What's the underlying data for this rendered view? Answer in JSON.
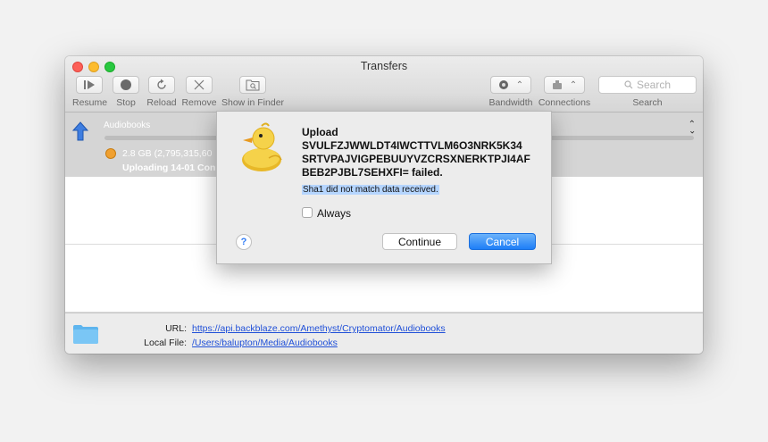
{
  "window": {
    "title": "Transfers"
  },
  "toolbar": {
    "resume": "Resume",
    "stop": "Stop",
    "reload": "Reload",
    "remove": "Remove",
    "show_in_finder": "Show in Finder",
    "bandwidth": "Bandwidth",
    "connections": "Connections",
    "search_label": "Search",
    "search_placeholder": "Search"
  },
  "transfer": {
    "name": "Audiobooks",
    "size": "2.8 GB (2,795,315,60",
    "status": "Uploading 14-01 Con",
    "progress": 0
  },
  "footer": {
    "url_label": "URL:",
    "url": "https://api.backblaze.com/Amethyst/Cryptomator/Audiobooks",
    "local_label": "Local File:",
    "local": "/Users/balupton/Media/Audiobooks"
  },
  "dialog": {
    "heading_line1": "Upload",
    "heading_line2": "SVULFZJWWLDT4IWCTTVLM6O3NRK5K34",
    "heading_line3": "SRTVPAJVIGPEBUUYVZCRSXNERKTPJI4AF",
    "heading_line4": "BEB2PJBL7SEHXFI= failed.",
    "message": "Sha1 did not match data received.",
    "checkbox_label": "Always",
    "help": "?",
    "continue": "Continue",
    "cancel": "Cancel"
  },
  "colors": {
    "accent": "#1e7ef7",
    "selection": "#d5d5d5",
    "link": "#2050d8"
  }
}
